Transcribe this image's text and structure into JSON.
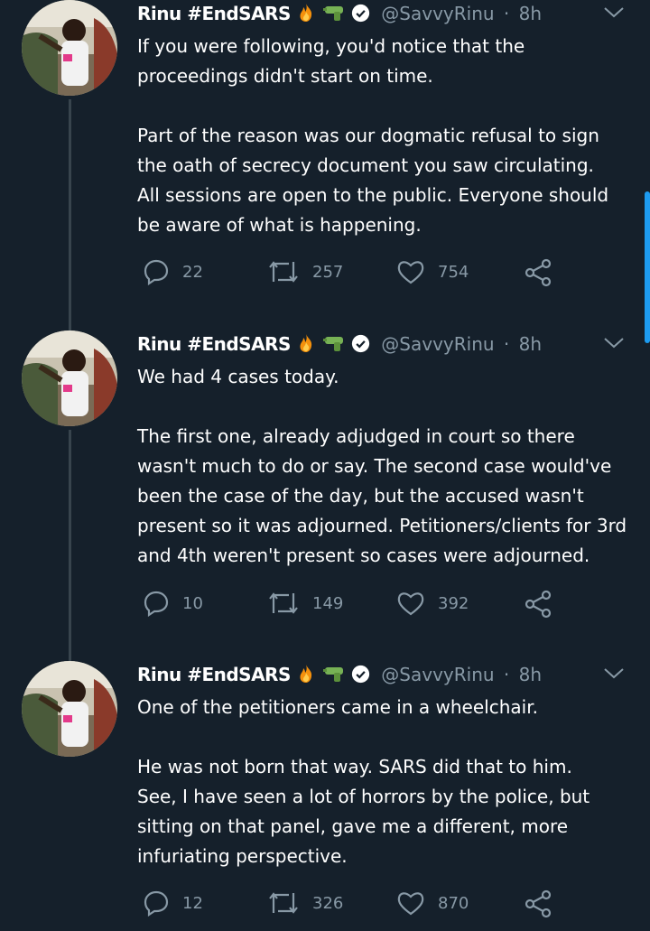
{
  "tweets": [
    {
      "name": "Rinu #EndSARS",
      "handle": "@SavvyRinu",
      "dot": "·",
      "time": "8h",
      "paragraphs": [
        "If you were following, you'd notice that the proceedings didn't start on time.",
        "Part of the reason was our dogmatic refusal to sign the oath of secrecy document you saw circulating.\nAll sessions are open to the public. Everyone should be aware of what is happening."
      ],
      "replies": "22",
      "retweets": "257",
      "likes": "754"
    },
    {
      "name": "Rinu #EndSARS",
      "handle": "@SavvyRinu",
      "dot": "·",
      "time": "8h",
      "paragraphs": [
        "We had 4 cases today.",
        "The first one, already adjudged in court so there wasn't much to do or say. The second case would've been the case of the day, but the accused wasn't present so it was adjourned. Petitioners/clients for 3rd and 4th weren't present so cases were adjourned."
      ],
      "replies": "10",
      "retweets": "149",
      "likes": "392"
    },
    {
      "name": "Rinu #EndSARS",
      "handle": "@SavvyRinu",
      "dot": "·",
      "time": "8h",
      "paragraphs": [
        "One of the petitioners came in a wheelchair.",
        "He was not born that way. SARS did that to him.\nSee, I have seen a lot of horrors by the police, but sitting on that panel, gave me a different, more infuriating perspective."
      ],
      "replies": "12",
      "retweets": "326",
      "likes": "870"
    }
  ],
  "colors": {
    "background": "#15202b",
    "secondary_text": "#8899a6",
    "thread_line": "#38444d"
  },
  "icons": [
    "reply-icon",
    "retweet-icon",
    "like-icon",
    "share-icon",
    "chevron-down-icon",
    "verified-badge-icon",
    "fire-emoji",
    "water-pistol-emoji"
  ]
}
